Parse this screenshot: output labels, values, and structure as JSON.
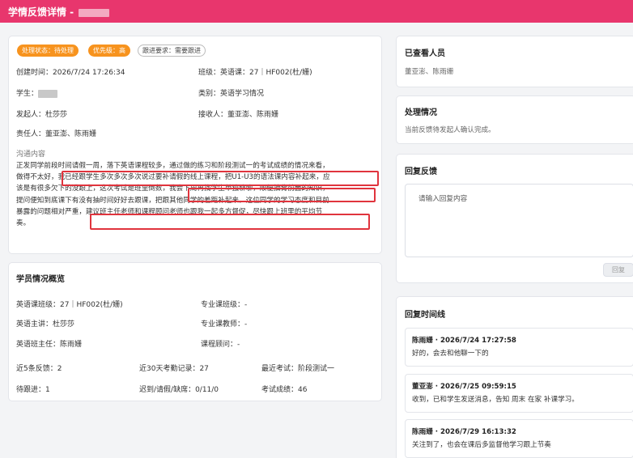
{
  "header": {
    "title": "学情反馈详情 - "
  },
  "tags": {
    "status": "处理状态：待处理",
    "priority": "优先级：高",
    "follow": "跟进要求：需要跟进"
  },
  "info": {
    "created": "创建时间：2026/7/24 17:26:34",
    "class": "班级：英语课：27｜HF002(杜/姗)",
    "student_label": "学生：",
    "category": "类别：英语学习情况",
    "initiator": "发起人：杜莎莎",
    "receiver": "接收人：董亚澎、陈雨姗",
    "owner": "责任人：董亚澎、陈雨姗"
  },
  "comm": {
    "label": "沟通内容",
    "lines": [
      "正发同学前段时间请假一周，落下英语课程较多，通过做的练习和阶段测试一的考试成绩的情况来看，",
      "做得不太好，我已经跟学生多次多次多次说过要补请假的线上课程，把U1-U3的语法课内容补起来，应",
      "该是有很多欠下的没跟上，这次考试是班里倒数，我会下周再找学生单独聊聊，顺便抽背前面的知识，",
      "提问便知到底课下有没有抽时间好好去跟课，把跟其他同学的差距补起来。这位同学的学习态度和目前",
      "暴露的问题相对严重，建议班主任老师和课程顾问老师也跟我一起多方督促，尽快跟上班里的平均节",
      "奏。"
    ]
  },
  "overview": {
    "title": "学员情况概览",
    "english_class": "英语课班级：27｜HF002(杜/姗)",
    "major_class": "专业课班级：-",
    "english_teacher": "英语主讲：杜莎莎",
    "major_teacher": "专业课教师：-",
    "english_hr": "英语班主任：陈雨姗",
    "advisor": "课程顾问：-",
    "recent_feedback": "近5条反馈：2",
    "attendance": "近30天考勤记录：27",
    "recent_exam": "最近考试：阶段测试一",
    "pending": "待跟进：1",
    "late_leave_absent": "迟到/请假/缺席：0/11/0",
    "exam_score": "考试成绩：46"
  },
  "viewed": {
    "title": "已查看人员",
    "names": "董亚澎、陈雨姗"
  },
  "processing": {
    "title": "处理情况",
    "text": "当前反馈待发起人确认完成。"
  },
  "reply": {
    "title": "回复反馈",
    "placeholder": "请输入回复内容",
    "button": "回复"
  },
  "timeline": {
    "title": "回复时间线",
    "items": [
      {
        "author": "陈雨姗 · 2026/7/24 17:27:58",
        "text": "好的，会去和他聊一下的"
      },
      {
        "author": "董亚澎 · 2026/7/25 09:59:15",
        "text": "收到，已和学生发送消息，告知 周末 在家 补课学习。"
      },
      {
        "author": "陈雨姗 · 2026/7/29 16:13:32",
        "text": "关注到了，也会在课后多监督他学习跟上节奏"
      }
    ]
  }
}
